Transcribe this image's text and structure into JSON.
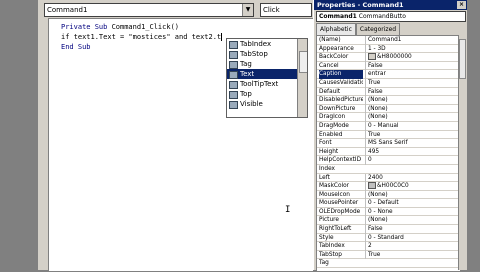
{
  "code_window": {
    "object_combo": "Command1",
    "procedure_combo": "Click",
    "lines": [
      {
        "kw": "Private Sub",
        "rest": " Command1_Click()"
      },
      {
        "kw": "",
        "rest": "if text1.Text = \"mostices\" and text2.t"
      },
      {
        "kw": "End Sub",
        "rest": ""
      }
    ]
  },
  "intellisense": {
    "items": [
      "TabIndex",
      "TabStop",
      "Tag",
      "Text",
      "ToolTipText",
      "Top",
      "Visible"
    ],
    "selected_index": 3
  },
  "properties": {
    "title": "Properties - Command1",
    "object_label": "Command1",
    "object_type": "CommandButto",
    "tabs": [
      "Alphabetic",
      "Categorized"
    ],
    "active_tab": 0,
    "selected_index": 4,
    "rows": [
      {
        "name": "(Name)",
        "value": "Command1"
      },
      {
        "name": "Appearance",
        "value": "1 - 3D"
      },
      {
        "name": "BackColor",
        "value": "&H8000000",
        "color": "#d4d0c8"
      },
      {
        "name": "Cancel",
        "value": "False"
      },
      {
        "name": "Caption",
        "value": "entrar"
      },
      {
        "name": "CausesValidatio",
        "value": "True"
      },
      {
        "name": "Default",
        "value": "False"
      },
      {
        "name": "DisabledPicture",
        "value": "(None)"
      },
      {
        "name": "DownPicture",
        "value": "(None)"
      },
      {
        "name": "DragIcon",
        "value": "(None)"
      },
      {
        "name": "DragMode",
        "value": "0 - Manual"
      },
      {
        "name": "Enabled",
        "value": "True"
      },
      {
        "name": "Font",
        "value": "MS Sans Serif"
      },
      {
        "name": "Height",
        "value": "495"
      },
      {
        "name": "HelpContextID",
        "value": "0"
      },
      {
        "name": "Index",
        "value": ""
      },
      {
        "name": "Left",
        "value": "2400"
      },
      {
        "name": "MaskColor",
        "value": "&H00C0C0",
        "color": "#c0c0c0"
      },
      {
        "name": "MouseIcon",
        "value": "(None)"
      },
      {
        "name": "MousePointer",
        "value": "0 - Default"
      },
      {
        "name": "OLEDropMode",
        "value": "0 - None"
      },
      {
        "name": "Picture",
        "value": "(None)"
      },
      {
        "name": "RightToLeft",
        "value": "False"
      },
      {
        "name": "Style",
        "value": "0 - Standard"
      },
      {
        "name": "TabIndex",
        "value": "2"
      },
      {
        "name": "TabStop",
        "value": "True"
      },
      {
        "name": "Tag",
        "value": ""
      }
    ]
  },
  "icons": {
    "close": "close-icon",
    "dropdown": "chevron-down-icon"
  }
}
